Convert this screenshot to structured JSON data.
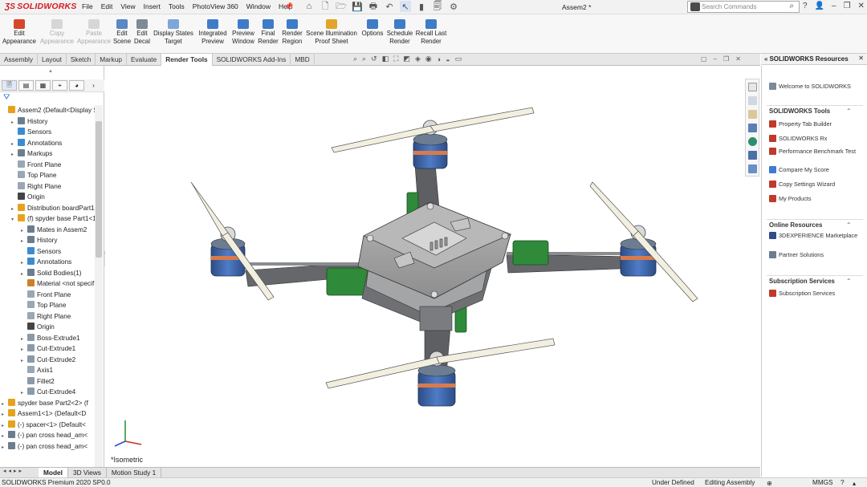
{
  "app": {
    "logo": "SOLIDWORKS",
    "document_title": "Assem2 *"
  },
  "menu": [
    "File",
    "Edit",
    "View",
    "Insert",
    "Tools",
    "PhotoView 360",
    "Window",
    "Help"
  ],
  "search": {
    "placeholder": "Search Commands"
  },
  "commands": [
    {
      "line1": "Edit",
      "line2": "Appearance",
      "enabled": true,
      "color": "#d6472b"
    },
    {
      "line1": "Copy",
      "line2": "Appearance",
      "enabled": false,
      "color": "#999999"
    },
    {
      "line1": "Paste",
      "line2": "Appearance",
      "enabled": false,
      "color": "#999999"
    },
    {
      "line1": "Edit",
      "line2": "Scene",
      "enabled": true,
      "color": "#5a87c6"
    },
    {
      "line1": "Edit",
      "line2": "Decal",
      "enabled": true,
      "color": "#7e8a96"
    },
    {
      "line1": "Display States",
      "line2": "Target",
      "enabled": true,
      "color": "#7ea6d8"
    },
    {
      "line1": "Integrated",
      "line2": "Preview",
      "enabled": true,
      "color": "#3e7cc7"
    },
    {
      "line1": "Preview",
      "line2": "Window",
      "enabled": true,
      "color": "#3e7cc7"
    },
    {
      "line1": "Final",
      "line2": "Render",
      "enabled": true,
      "color": "#3e7cc7"
    },
    {
      "line1": "Render",
      "line2": "Region",
      "enabled": true,
      "color": "#3e7cc7"
    },
    {
      "line1": "Scene Illumination",
      "line2": "Proof Sheet",
      "enabled": true,
      "color": "#e0a52a"
    },
    {
      "line1": "Options",
      "line2": "",
      "enabled": true,
      "color": "#3e7cc7"
    },
    {
      "line1": "Schedule",
      "line2": "Render",
      "enabled": true,
      "color": "#3e7cc7"
    },
    {
      "line1": "Recall Last",
      "line2": "Render",
      "enabled": true,
      "color": "#3e7cc7"
    }
  ],
  "tabs": [
    {
      "label": "Assembly",
      "active": false
    },
    {
      "label": "Layout",
      "active": false
    },
    {
      "label": "Sketch",
      "active": false
    },
    {
      "label": "Markup",
      "active": false
    },
    {
      "label": "Evaluate",
      "active": false
    },
    {
      "label": "Render Tools",
      "active": true
    },
    {
      "label": "SOLIDWORKS Add-Ins",
      "active": false
    },
    {
      "label": "MBD",
      "active": false
    }
  ],
  "tree": [
    {
      "label": "Assem2  (Default<Display S",
      "depth": 0,
      "arrow": "",
      "color": "#e7a21d"
    },
    {
      "label": "History",
      "depth": 1,
      "arrow": "▸",
      "color": "#6b7d8f"
    },
    {
      "label": "Sensors",
      "depth": 1,
      "arrow": "",
      "color": "#3b8bd0"
    },
    {
      "label": "Annotations",
      "depth": 1,
      "arrow": "▸",
      "color": "#3b8bd0"
    },
    {
      "label": "Markups",
      "depth": 1,
      "arrow": "▸",
      "color": "#6b7d8f"
    },
    {
      "label": "Front Plane",
      "depth": 1,
      "arrow": "",
      "color": "#9aa7b4"
    },
    {
      "label": "Top Plane",
      "depth": 1,
      "arrow": "",
      "color": "#9aa7b4"
    },
    {
      "label": "Right Plane",
      "depth": 1,
      "arrow": "",
      "color": "#9aa7b4"
    },
    {
      "label": "Origin",
      "depth": 1,
      "arrow": "",
      "color": "#444444"
    },
    {
      "label": "Distribution boardPart1",
      "depth": 1,
      "arrow": "▸",
      "color": "#e7a21d"
    },
    {
      "label": "(f) spyder base Part1<1>",
      "depth": 1,
      "arrow": "▾",
      "color": "#e7a21d"
    },
    {
      "label": "Mates in Assem2",
      "depth": 2,
      "arrow": "▸",
      "color": "#6b7d8f"
    },
    {
      "label": "History",
      "depth": 2,
      "arrow": "▸",
      "color": "#6b7d8f"
    },
    {
      "label": "Sensors",
      "depth": 2,
      "arrow": "",
      "color": "#3b8bd0"
    },
    {
      "label": "Annotations",
      "depth": 2,
      "arrow": "▸",
      "color": "#3b8bd0"
    },
    {
      "label": "Solid Bodies(1)",
      "depth": 2,
      "arrow": "▸",
      "color": "#6b7d8f"
    },
    {
      "label": "Material <not specif",
      "depth": 2,
      "arrow": "",
      "color": "#c8822b"
    },
    {
      "label": "Front Plane",
      "depth": 2,
      "arrow": "",
      "color": "#9aa7b4"
    },
    {
      "label": "Top Plane",
      "depth": 2,
      "arrow": "",
      "color": "#9aa7b4"
    },
    {
      "label": "Right Plane",
      "depth": 2,
      "arrow": "",
      "color": "#9aa7b4"
    },
    {
      "label": "Origin",
      "depth": 2,
      "arrow": "",
      "color": "#444444"
    },
    {
      "label": "Boss-Extrude1",
      "depth": 2,
      "arrow": "▸",
      "color": "#8a9aa8"
    },
    {
      "label": "Cut-Extrude1",
      "depth": 2,
      "arrow": "▸",
      "color": "#8a9aa8"
    },
    {
      "label": "Cut-Extrude2",
      "depth": 2,
      "arrow": "▸",
      "color": "#8a9aa8"
    },
    {
      "label": "Axis1",
      "depth": 2,
      "arrow": "",
      "color": "#9aa7b4"
    },
    {
      "label": "Fillet2",
      "depth": 2,
      "arrow": "",
      "color": "#8a9aa8"
    },
    {
      "label": "Cut-Extrude4",
      "depth": 2,
      "arrow": "▸",
      "color": "#8a9aa8"
    },
    {
      "label": "spyder base Part2<2> (f",
      "depth": 0,
      "arrow": "▸",
      "color": "#e7a21d"
    },
    {
      "label": "Assem1<1> (Default<D",
      "depth": 0,
      "arrow": "▸",
      "color": "#e7a21d"
    },
    {
      "label": "(-) spacer<1> (Default<",
      "depth": 0,
      "arrow": "▸",
      "color": "#e7a21d"
    },
    {
      "label": "(-) pan cross head_am<",
      "depth": 0,
      "arrow": "▸",
      "color": "#6b7d8f"
    },
    {
      "label": "(-) pan cross head_am<",
      "depth": 0,
      "arrow": "▸",
      "color": "#6b7d8f"
    }
  ],
  "viewport": {
    "orientation_label": "*Isometric"
  },
  "bottom_tabs": [
    {
      "label": "Model",
      "active": true
    },
    {
      "label": "3D Views",
      "active": false
    },
    {
      "label": "Motion Study 1",
      "active": false
    }
  ],
  "status": {
    "product": "SOLIDWORKS Premium 2020 SP0.0",
    "definition": "Under Defined",
    "mode": "Editing Assembly",
    "units": "MMGS"
  },
  "resources": {
    "title": "SOLIDWORKS Resources",
    "welcome": "Welcome to SOLIDWORKS",
    "tools_header": "SOLIDWORKS Tools",
    "tools": [
      "Property Tab Builder",
      "SOLIDWORKS Rx",
      "Performance Benchmark Test",
      "Compare My Score",
      "Copy Settings Wizard",
      "My Products"
    ],
    "online_header": "Online Resources",
    "online": [
      "3DEXPERIENCE Marketplace",
      "Partner Solutions"
    ],
    "sub_header": "Subscription Services",
    "sub": [
      "Subscription Services"
    ]
  }
}
